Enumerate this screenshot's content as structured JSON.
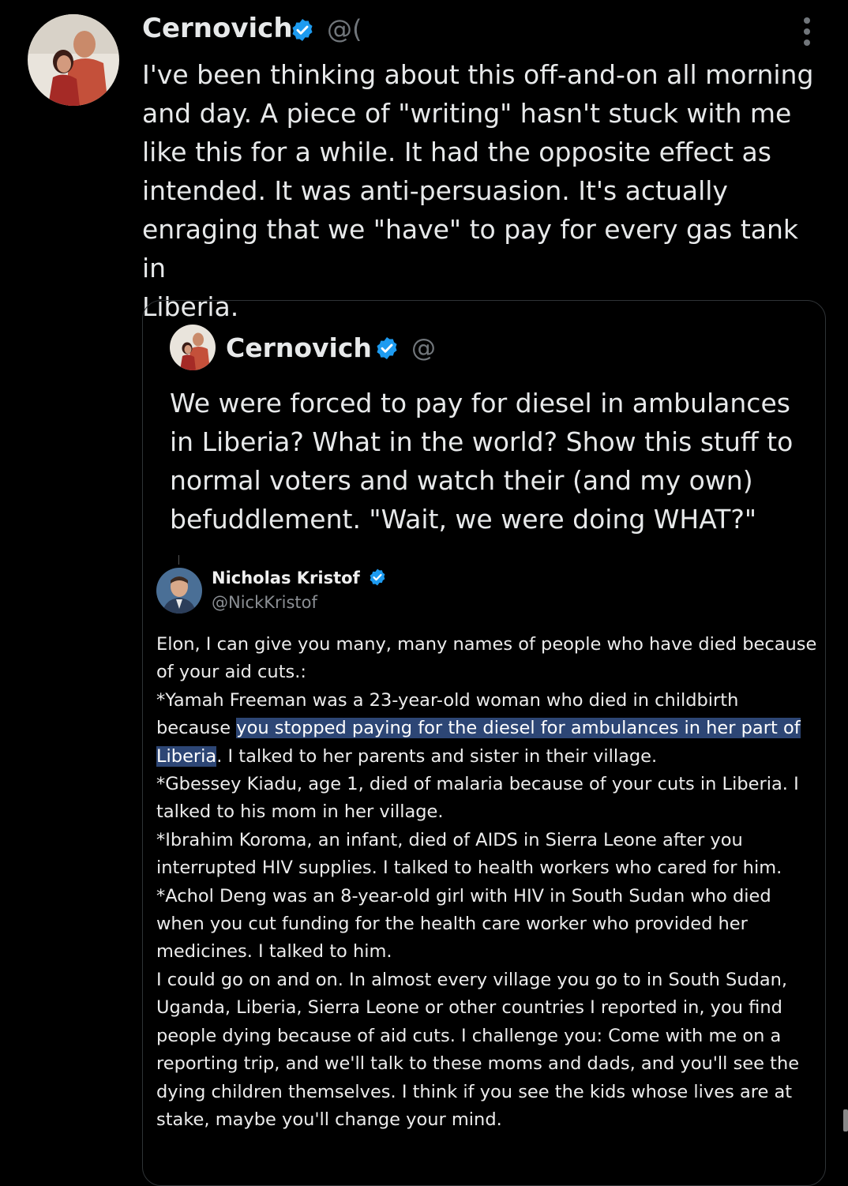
{
  "tweet": {
    "author_name": "Cernovich",
    "handle": "@(",
    "text": "I've been thinking about this off-and-on all morning\nand day. A piece of \"writing\" hasn't stuck with me\nlike this for a while. It had the opposite effect as\nintended. It was anti-persuasion. It's actually\nenraging that we \"have\" to pay for every gas tank in\nLiberia."
  },
  "quote": {
    "author_name": "Cernovich",
    "handle": "@",
    "text": "We were forced to pay for diesel in ambulances in Liberia? What in the world? Show this stuff to normal voters and watch their (and my own) befuddlement. \"Wait, we were doing WHAT?\""
  },
  "screenshot_tweet": {
    "author_name": "Nicholas Kristof",
    "handle": "@NickKristof",
    "text_part1": "Elon, I can give you many, many names of people who have died because\nof your aid cuts.:\n*Yamah Freeman was a 23-year-old woman who died in childbirth\nbecause ",
    "text_highlight": "you stopped paying for the diesel for ambulances in her part of\nLiberia",
    "text_part2": ". I talked to her parents and sister in their village.\n*Gbessey Kiadu, age 1, died of malaria because of your cuts in Liberia. I\ntalked to his mom in her village.\n*Ibrahim Koroma, an infant, died of AIDS in Sierra Leone after you\ninterrupted HIV supplies. I talked to health workers who cared for him.\n*Achol Deng was an 8-year-old girl with HIV in South Sudan who died\nwhen you cut funding for the health care worker who provided her\nmedicines. I talked to him.\n  I could go on and on. In almost every village you go to in South Sudan,\nUganda, Liberia, Sierra Leone or other countries I reported in, you find\npeople dying because of aid cuts. I challenge you: Come with me on a\nreporting trip, and we'll talk to these moms and dads, and you'll see the\ndying children themselves. I think if you see the kids whose lives are at\nstake, maybe you'll change your mind."
  },
  "colors": {
    "background": "#000000",
    "verified": "#1d9bf0",
    "highlight": "#2d4675",
    "muted": "#71767b"
  },
  "icons": [
    "verified-badge-icon",
    "more-options-icon"
  ]
}
